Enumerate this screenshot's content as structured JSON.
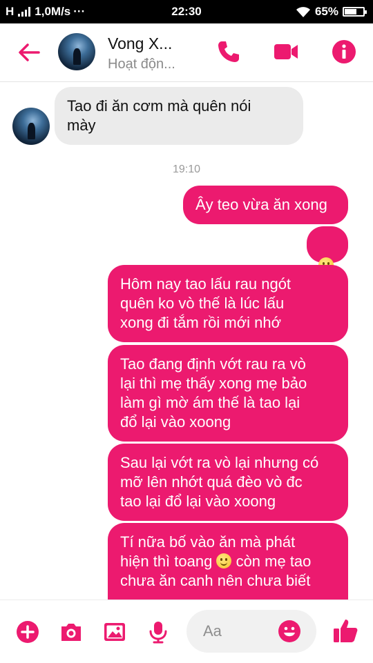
{
  "status_bar": {
    "network": "H",
    "speed": "1,0M/s",
    "more": "···",
    "time": "22:30",
    "battery": "65%",
    "battery_level": 0.65
  },
  "header": {
    "contact_name": "Vong X...",
    "contact_status": "Hoạt độn...",
    "icons": [
      "back-arrow-icon",
      "phone-icon",
      "video-icon",
      "info-icon"
    ],
    "accent_color": "#ec1a6f"
  },
  "chat": {
    "incoming": [
      {
        "text": "Tao đi ăn cơm mà quên nói\nmày"
      }
    ],
    "timestamp": "19:10",
    "outgoing": [
      {
        "text": "Ây teo vừa ăn xong"
      },
      {
        "emoji": "smile-emoji"
      },
      {
        "text": "Hôm nay tao lấu rau ngót\nquên ko vò thế là lúc lấu\nxong đi tắm rồi mới nhớ"
      },
      {
        "text": "Tao đang định vớt rau ra vò\nlại thì mẹ thấy xong mẹ bảo\nlàm gì mờ ám thế là tao lại\nđổ lại vào xoong"
      },
      {
        "text": "Sau lại vớt ra vò lại nhưng có\nmỡ lên nhớt quá đèo vò đc\ntao lại đổ lại vào xoong"
      },
      {
        "text_before_emoji": "Tí nữa bố vào ăn mà phát\nhiện thì toang ",
        "text_after_emoji": " còn mẹ tao\nchưa ăn canh nên chưa biết"
      }
    ]
  },
  "composer": {
    "placeholder": "Aa",
    "icons": [
      "plus-icon",
      "camera-icon",
      "image-icon",
      "microphone-icon",
      "emoji-icon",
      "thumbs-up-icon"
    ]
  }
}
